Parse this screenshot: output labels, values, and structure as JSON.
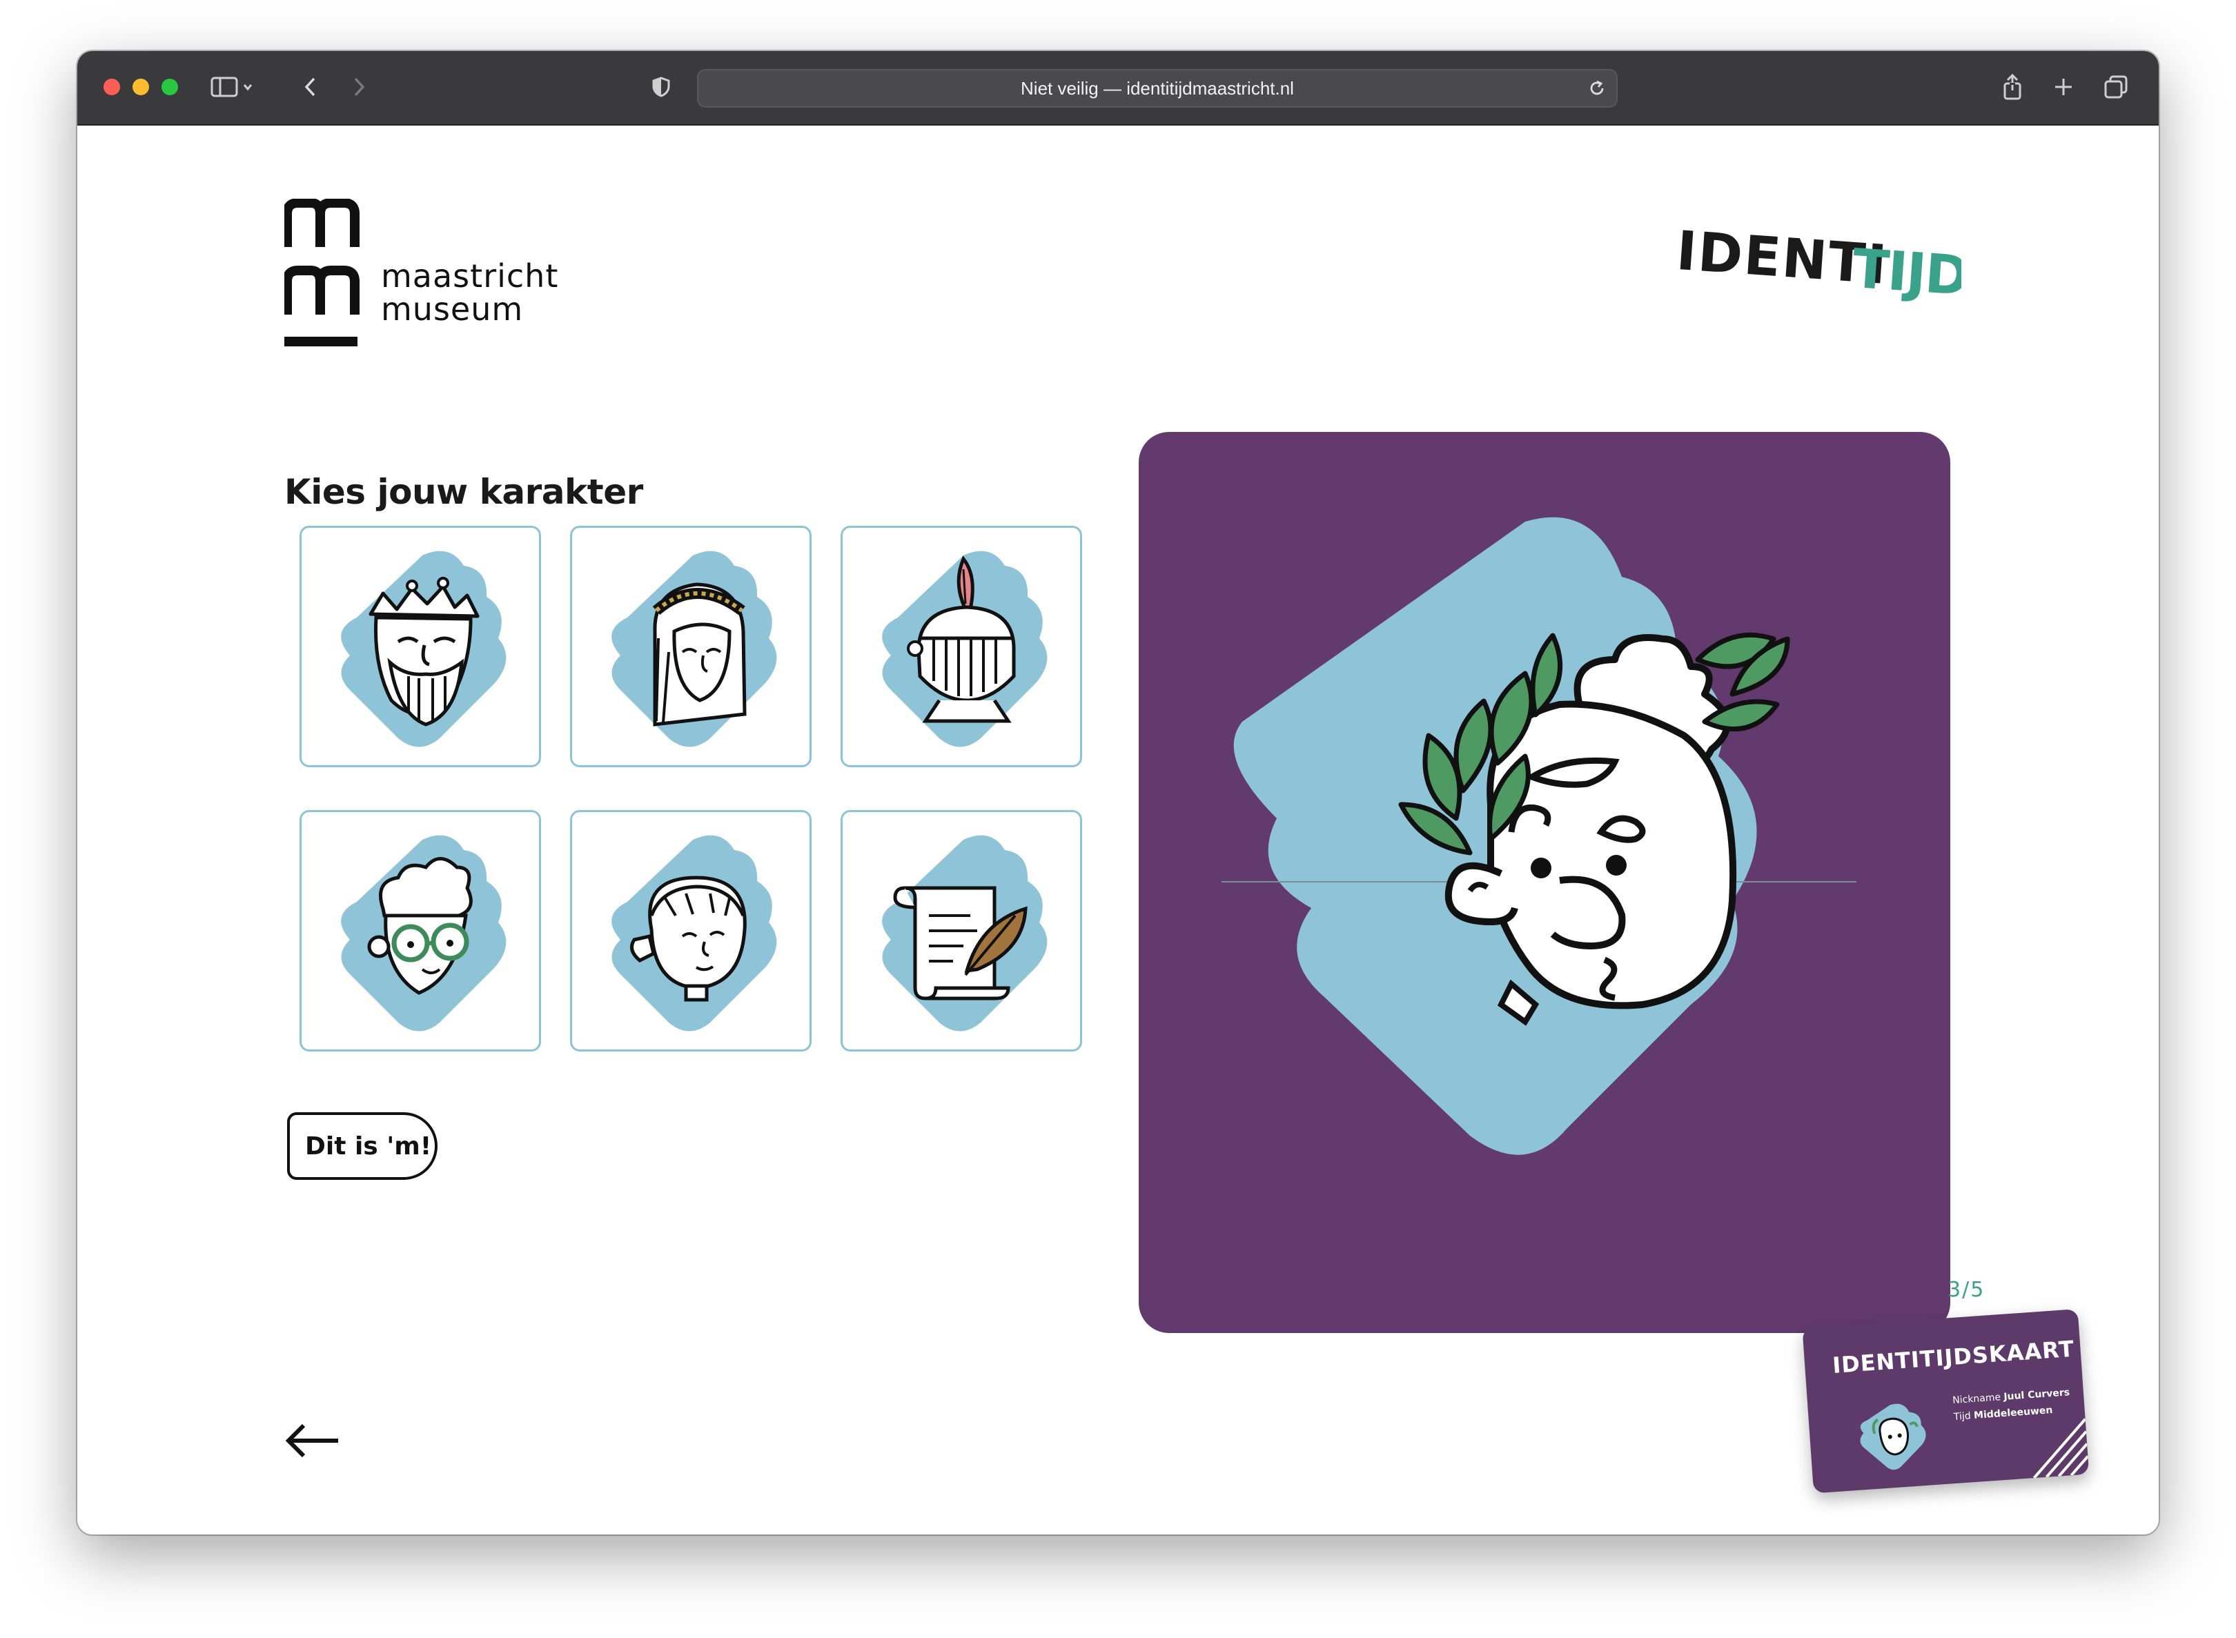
{
  "browser": {
    "address_text": "Niet veilig — identitijdmaastricht.nl"
  },
  "logo": {
    "line1": "maastricht",
    "line2": "museum"
  },
  "brand": {
    "word_dark": "IDENTI",
    "word_teal": "TIJD"
  },
  "main": {
    "heading": "Kies jouw karakter",
    "characters": [
      {
        "icon": "king-icon"
      },
      {
        "icon": "lady-icon"
      },
      {
        "icon": "knight-helmet-icon"
      },
      {
        "icon": "scholar-glasses-icon"
      },
      {
        "icon": "child-icon"
      },
      {
        "icon": "scroll-quill-icon"
      }
    ],
    "confirm_label": "Dit is 'm!"
  },
  "preview": {
    "selected": "laurel-emperor-icon"
  },
  "progress": {
    "label": "3/5",
    "step": 3,
    "total": 5
  },
  "card": {
    "title": "IDENTITIJDSKAART",
    "nickname_label": "Nickname",
    "nickname_value": "Juul Curvers",
    "time_label": "Tijd",
    "time_value": "Middeleeuwen"
  },
  "colors": {
    "purple": "#623a6d",
    "light_blue": "#8ec3d8",
    "teal": "#3aa18a",
    "leaf_green": "#4f9a62"
  }
}
